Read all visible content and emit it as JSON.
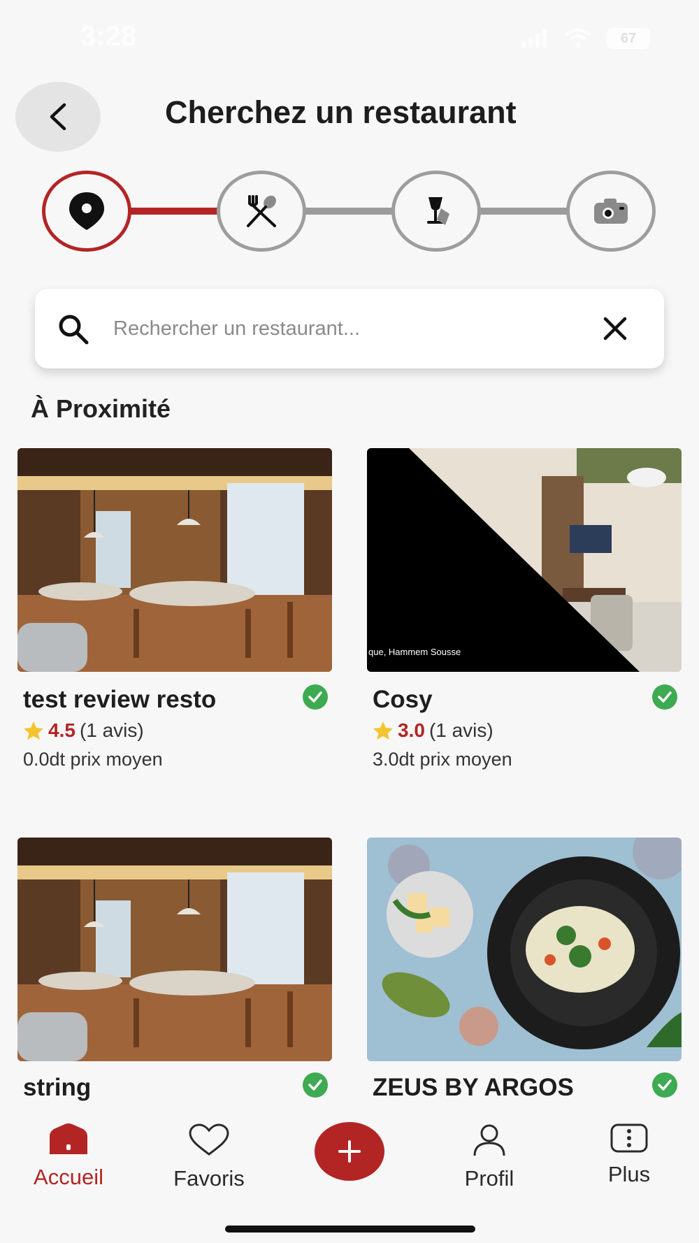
{
  "status_bar": {
    "time": "3:28",
    "battery": "67"
  },
  "header": {
    "title": "Cherchez un restaurant"
  },
  "stepper": {
    "steps": [
      {
        "icon": "location-pin-icon",
        "active": true
      },
      {
        "icon": "fork-spoon-icon",
        "active": false
      },
      {
        "icon": "wine-glass-icon",
        "active": false
      },
      {
        "icon": "camera-icon",
        "active": false
      }
    ]
  },
  "search": {
    "placeholder": "Rechercher un restaurant...",
    "value": ""
  },
  "section": {
    "title": "À Proximité"
  },
  "restaurants": [
    {
      "name": "test review resto",
      "rating": "4.5",
      "reviews": "(1 avis)",
      "price": "0.0dt prix moyen",
      "verified": true
    },
    {
      "name": "Cosy",
      "rating": "3.0",
      "reviews": "(1 avis)",
      "price": "3.0dt prix moyen",
      "verified": true,
      "image_caption": "que, Hammem Sousse"
    },
    {
      "name": "string",
      "verified": true
    },
    {
      "name": "ZEUS BY ARGOS",
      "verified": true
    }
  ],
  "bottom_nav": {
    "items": [
      {
        "label": "Accueil",
        "icon": "home-icon",
        "active": true
      },
      {
        "label": "Favoris",
        "icon": "heart-icon",
        "active": false
      },
      {
        "label": "",
        "icon": "plus-icon",
        "active": false
      },
      {
        "label": "Profil",
        "icon": "user-icon",
        "active": false
      },
      {
        "label": "Plus",
        "icon": "more-icon",
        "active": false
      }
    ]
  },
  "colors": {
    "accent": "#b32525",
    "verified": "#3eaa51",
    "star": "#f4c430",
    "inactive": "#9d9d9d"
  }
}
